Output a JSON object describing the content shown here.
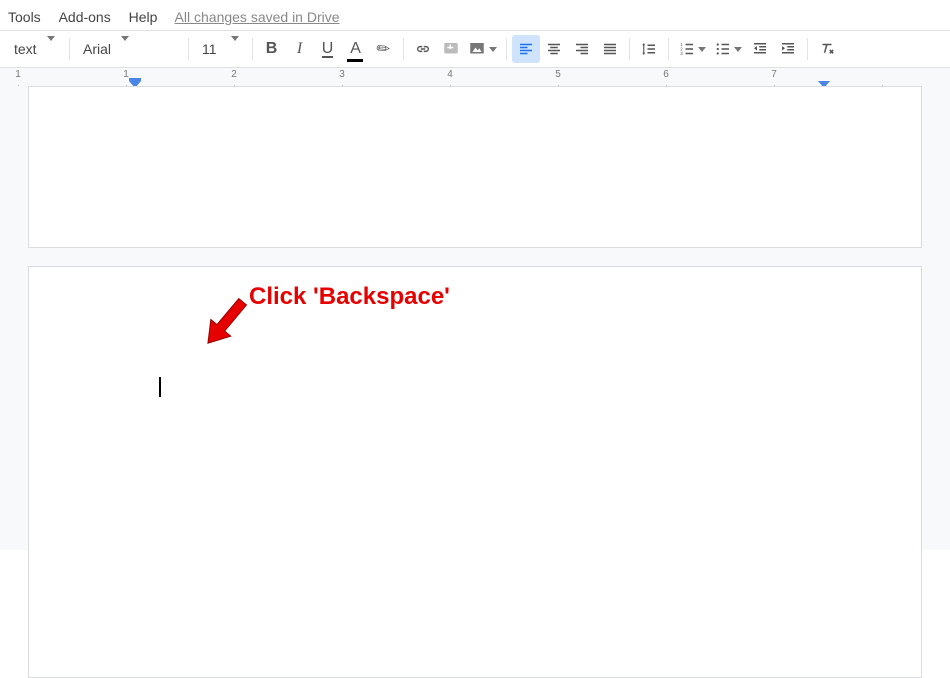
{
  "menu": {
    "tools": "Tools",
    "addons": "Add-ons",
    "help": "Help",
    "save_status": "All changes saved in Drive"
  },
  "toolbar": {
    "styles": "text",
    "font": "Arial",
    "size": "11"
  },
  "ruler": {
    "numbers": [
      "1",
      "1",
      "2",
      "3",
      "4",
      "5",
      "6",
      "7"
    ]
  },
  "annotation": {
    "text": "Click 'Backspace'"
  }
}
